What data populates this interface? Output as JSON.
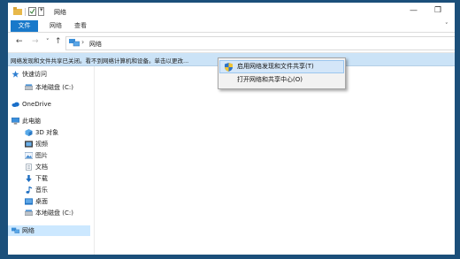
{
  "window": {
    "title": "网络"
  },
  "window_controls": {
    "minimize": "—",
    "maximize": "❐"
  },
  "ribbon": {
    "tabs": [
      "文件",
      "网络",
      "查看"
    ],
    "toggle": "˅"
  },
  "nav": {
    "back": "←",
    "forward": "→",
    "dropdown": "˅",
    "up": "↑"
  },
  "address": {
    "chevron": "›",
    "path": "网络"
  },
  "infobar": {
    "message": "网络发现和文件共享已关闭。看不到网络计算机和设备。单击以更改..."
  },
  "sidebar": {
    "items": [
      {
        "label": "快速访问",
        "icon": "star-icon"
      },
      {
        "label": "本地磁盘 (C:)",
        "icon": "drive-icon"
      },
      {
        "label": "OneDrive",
        "icon": "cloud-icon"
      },
      {
        "label": "此电脑",
        "icon": "computer-icon"
      },
      {
        "label": "3D 对象",
        "icon": "cube-icon"
      },
      {
        "label": "视频",
        "icon": "video-icon"
      },
      {
        "label": "图片",
        "icon": "picture-icon"
      },
      {
        "label": "文档",
        "icon": "document-icon"
      },
      {
        "label": "下载",
        "icon": "download-icon"
      },
      {
        "label": "音乐",
        "icon": "music-icon"
      },
      {
        "label": "桌面",
        "icon": "desktop-icon"
      },
      {
        "label": "本地磁盘 (C:)",
        "icon": "drive-icon"
      },
      {
        "label": "网络",
        "icon": "network-icon"
      }
    ]
  },
  "context_menu": {
    "items": [
      {
        "label": "启用网络发现和文件共享(T)",
        "icon": "shield-icon"
      },
      {
        "label": "打开网络和共享中心(O)"
      }
    ]
  },
  "colors": {
    "accent": "#1979ca",
    "infobar": "#cbe3f7",
    "selection": "#cce8ff",
    "desktop": "#1b4f7a"
  }
}
